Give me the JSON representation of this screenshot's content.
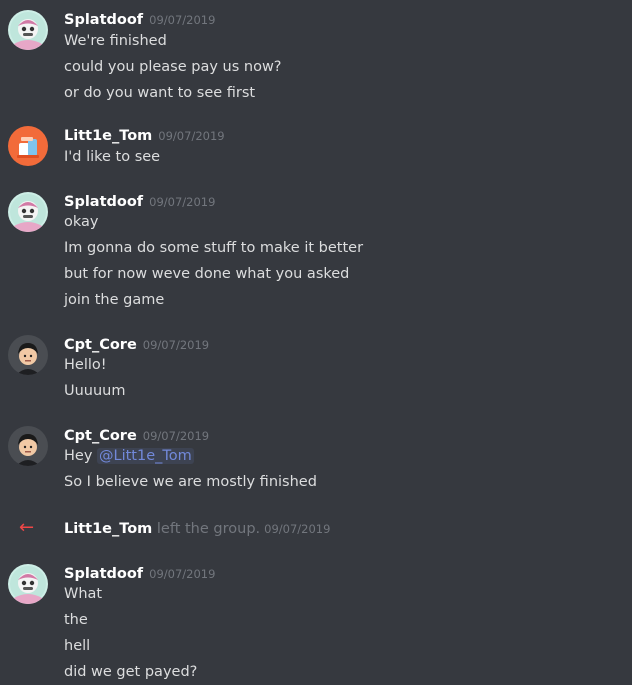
{
  "messages": [
    {
      "author": "Splatdoof",
      "timestamp": "09/07/2019",
      "lines": [
        "We're finished",
        "could you please pay us now?",
        "or do you want to see first"
      ]
    },
    {
      "author": "Litt1e_Tom",
      "timestamp": "09/07/2019",
      "lines": [
        "I'd like to see"
      ]
    },
    {
      "author": "Splatdoof",
      "timestamp": "09/07/2019",
      "lines": [
        "okay",
        "Im gonna do some stuff to make it better",
        "but for now weve done what you asked",
        "join the game"
      ]
    },
    {
      "author": "Cpt_Core",
      "timestamp": "09/07/2019",
      "lines": [
        "Hello!",
        "Uuuuum"
      ]
    },
    {
      "author": "Cpt_Core",
      "timestamp": "09/07/2019",
      "line1_prefix": "Hey ",
      "mention": "@Litt1e_Tom",
      "lines": [
        "So I believe we are mostly finished"
      ]
    },
    {
      "author": "Splatdoof",
      "timestamp": "09/07/2019",
      "lines": [
        "What",
        "the",
        "hell",
        "did we get payed?"
      ]
    }
  ],
  "system": {
    "user": "Litt1e_Tom",
    "action": " left the group.",
    "timestamp": "09/07/2019",
    "arrow": "←"
  },
  "colors": {
    "background": "#36393f",
    "username": "#ffffff",
    "message_text": "#dcddde",
    "timestamp": "#72767d",
    "mention": "#7289da",
    "leave_arrow": "#f04747"
  }
}
